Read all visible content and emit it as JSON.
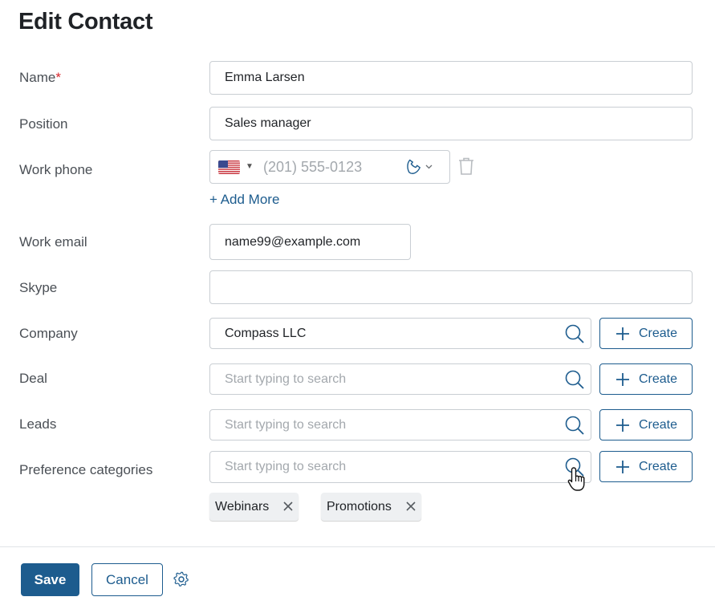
{
  "header": {
    "title": "Edit Contact"
  },
  "form": {
    "name": {
      "label": "Name",
      "required_mark": "*",
      "value": "Emma Larsen"
    },
    "position": {
      "label": "Position",
      "value": "Sales manager"
    },
    "work_phone": {
      "label": "Work phone",
      "country_flag_icon": "us-flag-icon",
      "placeholder": "(201) 555-0123",
      "type_icon": "phone-icon",
      "add_more": "+ Add More"
    },
    "work_email": {
      "label": "Work email",
      "value": "name99@example.com"
    },
    "skype": {
      "label": "Skype",
      "value": ""
    },
    "company": {
      "label": "Company",
      "value": "Compass LLC",
      "create_label": "Create"
    },
    "deal": {
      "label": "Deal",
      "placeholder": "Start typing to search",
      "create_label": "Create"
    },
    "leads": {
      "label": "Leads",
      "placeholder": "Start typing to search",
      "create_label": "Create"
    },
    "preference_categories": {
      "label": "Preference categories",
      "placeholder": "Start typing to search",
      "create_label": "Create",
      "tags": [
        "Webinars",
        "Promotions"
      ]
    }
  },
  "footer": {
    "save_label": "Save",
    "cancel_label": "Cancel",
    "settings_icon": "gear-icon"
  },
  "colors": {
    "accent": "#1d5c8e",
    "required": "#d7262c",
    "border": "#c9ced3",
    "placeholder": "#a3a8ad"
  }
}
